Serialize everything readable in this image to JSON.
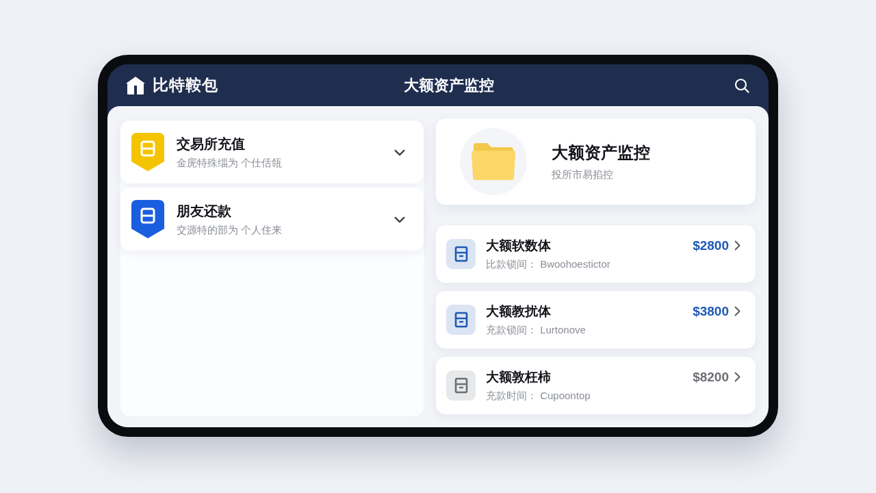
{
  "header": {
    "brand": "比特鞍包",
    "title": "大额资产监控"
  },
  "accounts": [
    {
      "title": "交易所充值",
      "subtitle": "金庑特殊缁为 个仕佸瓴",
      "color": "#f5c400",
      "expanded": false
    },
    {
      "title": "朋友还款",
      "subtitle": "交源特的部为 个人住来",
      "color": "#1a5ee0",
      "expanded": false
    }
  ],
  "summary": {
    "title": "大额资产监控",
    "subtitle": "投所市易掐控"
  },
  "transactions": [
    {
      "title": "大额软数体",
      "detail": "比款锁间： Bwoohoestictor",
      "amount": "$2800",
      "color": "#1d58b5"
    },
    {
      "title": "大额教扰体",
      "detail": "充款锁间： Lurtonove",
      "amount": "$3800",
      "color": "#1d58b5"
    },
    {
      "title": "大额敦枉柿",
      "detail": "充款时间： Cupoontop",
      "amount": "$8200",
      "color": "#6b6e74"
    }
  ]
}
